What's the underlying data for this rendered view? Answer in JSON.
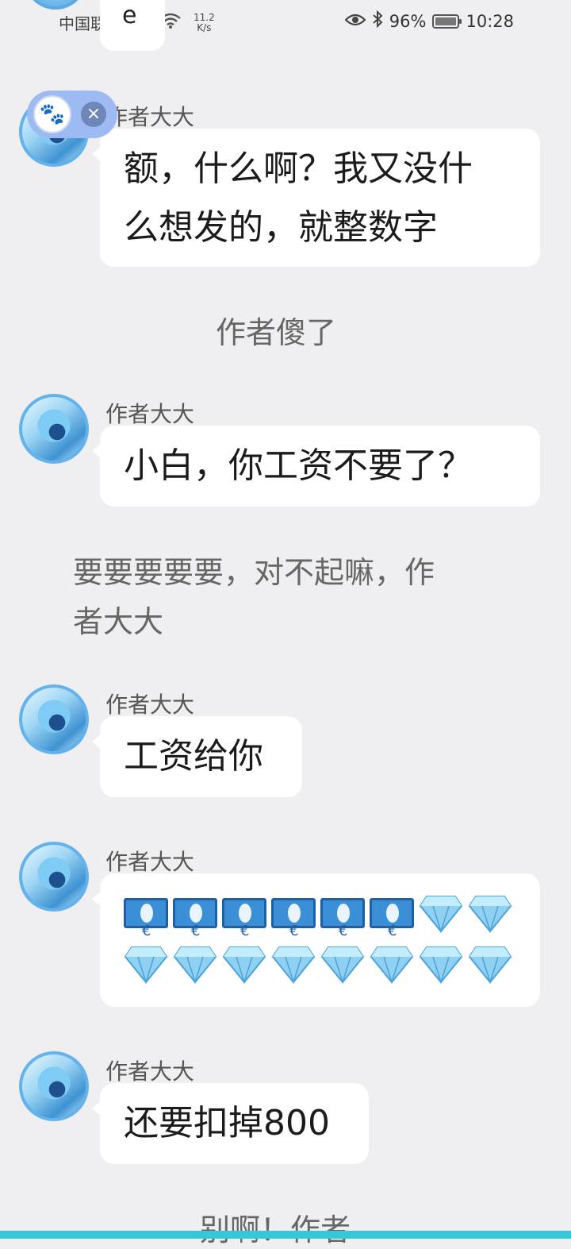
{
  "status_bar": {
    "carrier": "中国联通",
    "net_speed_value": "11.2",
    "net_speed_unit": "K/s",
    "battery": "96%",
    "time": "10:28"
  },
  "top_partial": {
    "text": "e"
  },
  "messages": [
    {
      "sender": "作者大大",
      "lines": [
        "额，什么啊？我又没什",
        "么想发的，就整数字"
      ]
    },
    {
      "narration": "作者傻了"
    },
    {
      "sender": "作者大大",
      "text": "小白，你工资不要了？"
    },
    {
      "narration_lines": [
        "要要要要要，对不起嘛，作",
        "者大大"
      ]
    },
    {
      "sender": "作者大大",
      "text": "工资给你"
    },
    {
      "sender": "作者大大",
      "emoji_rows": [
        [
          "cash-icon",
          "cash-icon",
          "cash-icon",
          "cash-icon",
          "cash-icon",
          "cash-icon",
          "diamond-icon",
          "diamond-icon"
        ],
        [
          "diamond-icon",
          "diamond-icon",
          "diamond-icon",
          "diamond-icon",
          "diamond-icon",
          "diamond-icon",
          "diamond-icon",
          "diamond-icon"
        ]
      ]
    },
    {
      "sender": "作者大大",
      "text": "还要扣掉800"
    }
  ],
  "bottom_partial": "别啊！作者",
  "floating_badge": {
    "icon": "paw-icon",
    "close": "×"
  },
  "colors": {
    "background": "#efeff1",
    "bubble": "#ffffff",
    "accent_bar": "#39c6d8",
    "avatar_ring": "#62b2ee"
  }
}
